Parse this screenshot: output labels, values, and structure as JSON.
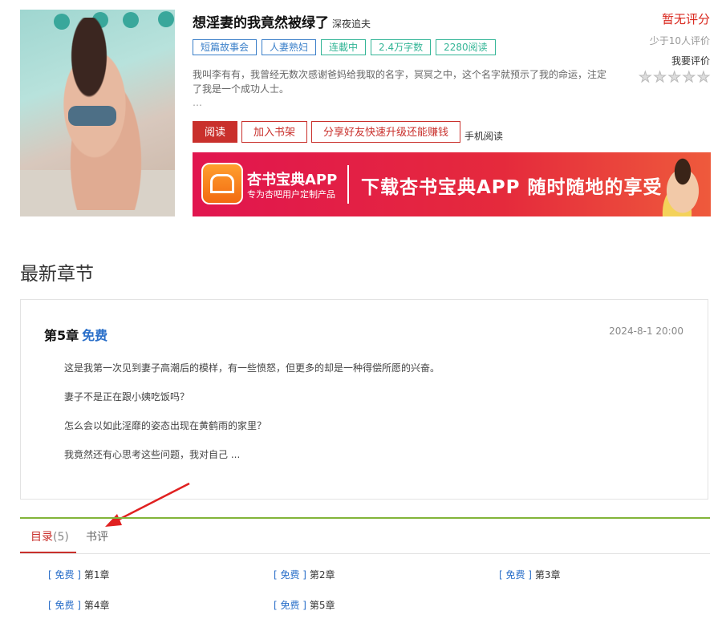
{
  "book": {
    "title": "想淫妻的我竟然被绿了",
    "author": "深夜追夫",
    "tags": [
      "短篇故事会",
      "人妻熟妇",
      "连載中",
      "2.4万字数",
      "2280阅读"
    ],
    "description": "我叫李有有，我曾经无数次感谢爸妈给我取的名字，冥冥之中，这个名字就预示了我的命运，注定了我是一个成功人士。",
    "ellipsis": "…"
  },
  "rating": {
    "status": "暂无评分",
    "count_note": "少于10人评价",
    "rate_label": "我要评价",
    "stars": 5
  },
  "actions": {
    "read": "阅读",
    "shelf": "加入书架",
    "share": "分享好友快速升级还能赚钱",
    "mobile": "手机阅读"
  },
  "banner": {
    "app_name": "杏书宝典APP",
    "app_sub": "专为杏吧用户定制产品",
    "slogan": "下载杏书宝典APP 随时随地的享受"
  },
  "latest": {
    "section_title": "最新章节",
    "chapter": "第5章",
    "free": "免费",
    "date": "2024-8-1 20:00",
    "paragraphs": [
      "这是我第一次见到妻子高潮后的模样，有一些愤怒，但更多的却是一种得偿所愿的兴奋。",
      "妻子不是正在跟小姨吃饭吗？",
      "怎么会以如此淫靡的姿态出现在黄鹤雨的家里？",
      "我竟然还有心思考这些问题，我对自己 ..."
    ]
  },
  "tabs": {
    "toc_label": "目录",
    "toc_count": "(5)",
    "review_label": "书评"
  },
  "toc": [
    {
      "free": "[ 免费 ]",
      "name": "第1章"
    },
    {
      "free": "[ 免费 ]",
      "name": "第2章"
    },
    {
      "free": "[ 免费 ]",
      "name": "第3章"
    },
    {
      "free": "[ 免费 ]",
      "name": "第4章"
    },
    {
      "free": "[ 免费 ]",
      "name": "第5章"
    }
  ]
}
